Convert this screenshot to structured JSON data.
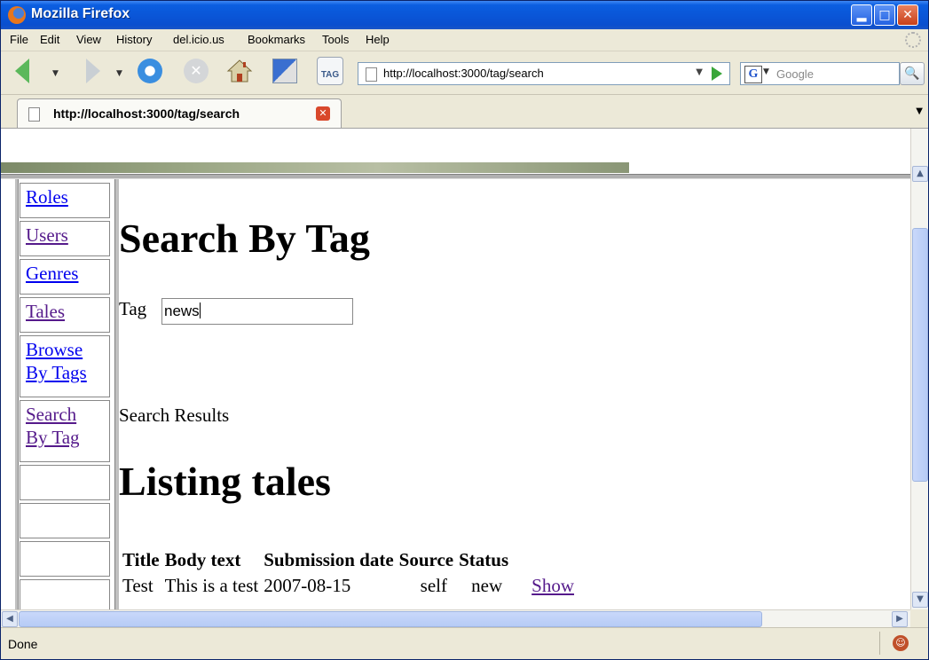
{
  "window": {
    "title": "Mozilla Firefox"
  },
  "menu": [
    "File",
    "Edit",
    "View",
    "History",
    "del.icio.us",
    "Bookmarks",
    "Tools",
    "Help"
  ],
  "toolbar": {
    "url": "http://localhost:3000/tag/search",
    "search_placeholder": "Google",
    "tag_button_label": "TAG"
  },
  "tab": {
    "label": "http://localhost:3000/tag/search"
  },
  "nav": {
    "roles": "Roles",
    "users": "Users",
    "genres": "Genres",
    "tales": "Tales",
    "browse_by_tags": "Browse By Tags",
    "search_by_tag": "Search By Tag"
  },
  "main": {
    "heading": "Search By Tag",
    "tag_label": "Tag",
    "tag_value": "news",
    "results_label": "Search Results",
    "listing_heading": "Listing tales",
    "table": {
      "headers": [
        "Title",
        "Body text",
        "Submission date",
        "Source",
        "Status"
      ],
      "rows": [
        {
          "title": "Test",
          "body": "This is a test",
          "date": "2007-08-15",
          "source": "self",
          "status": "new",
          "action": "Show"
        }
      ]
    }
  },
  "status": {
    "text": "Done"
  }
}
